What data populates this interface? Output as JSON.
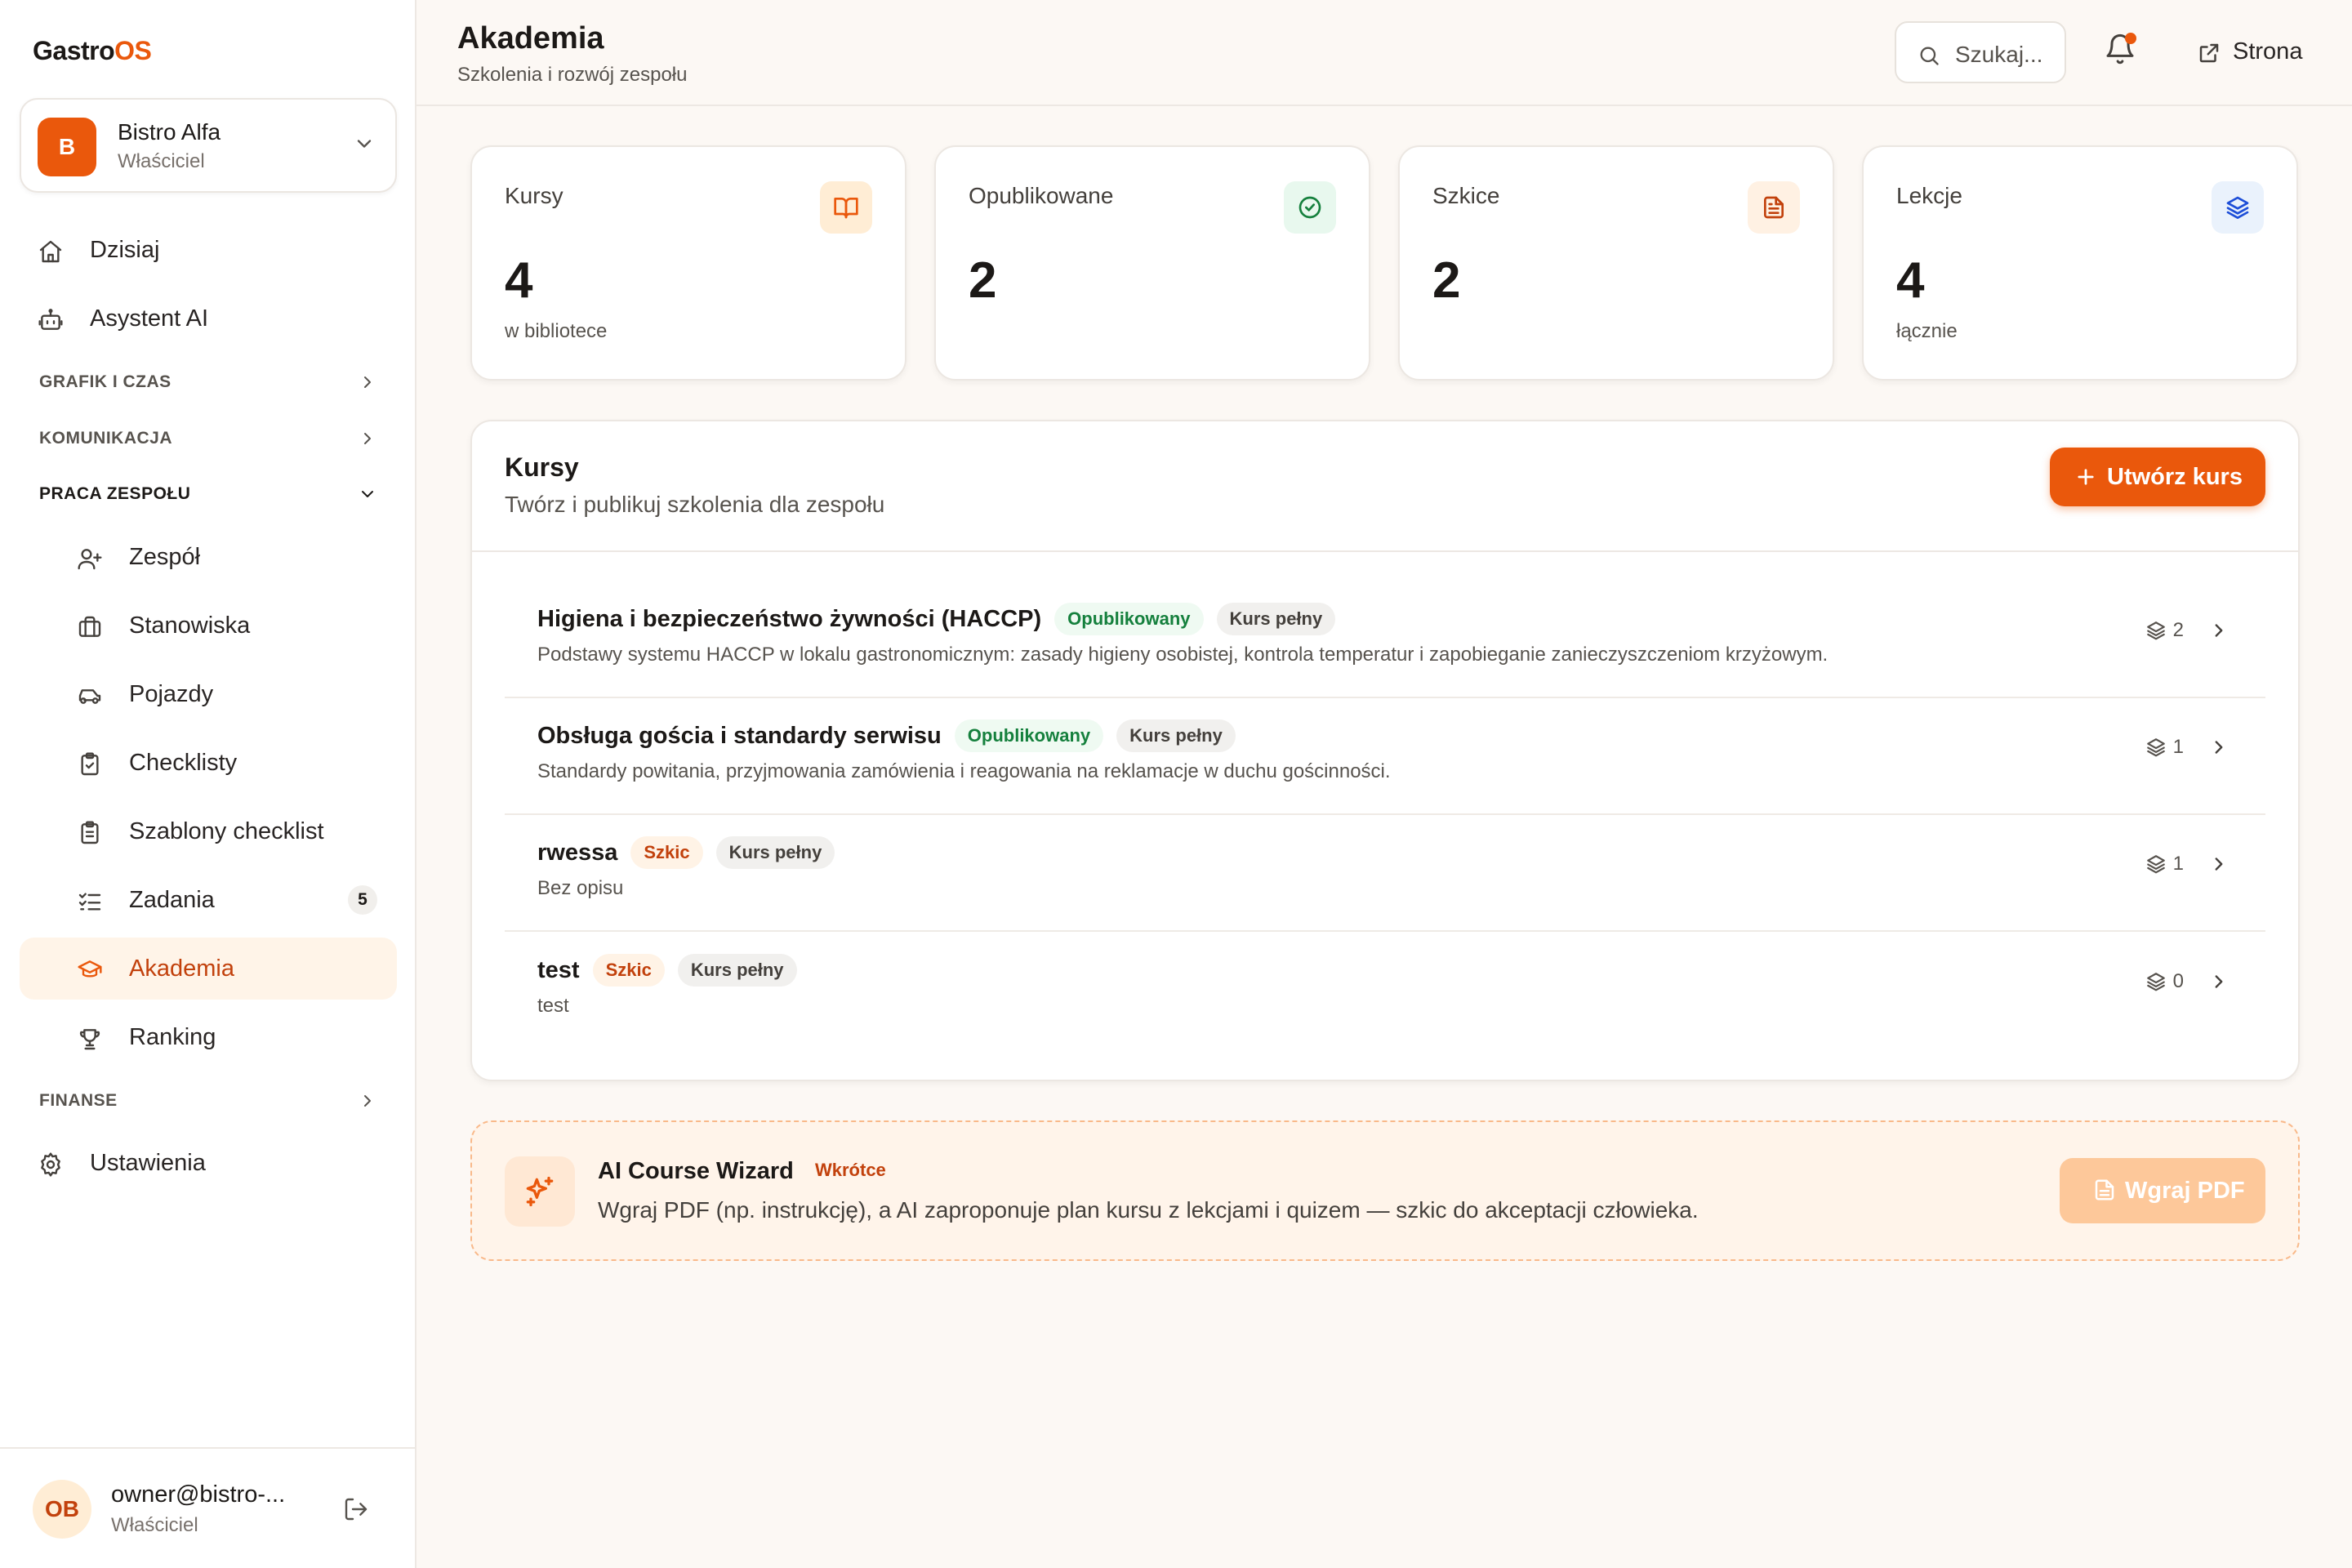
{
  "app": {
    "logo_main": "Gastro",
    "logo_accent": "OS"
  },
  "org": {
    "avatar": "B",
    "name": "Bistro Alfa",
    "role": "Właściciel"
  },
  "sidebar": {
    "top_items": [
      {
        "label": "Dzisiaj",
        "icon": "home-icon"
      },
      {
        "label": "Asystent AI",
        "icon": "bot-icon"
      }
    ],
    "sections": {
      "schedule": "GRAFIK I CZAS",
      "communication": "KOMUNIKACJA",
      "teamwork": "PRACA ZESPOŁU",
      "finance": "FINANSE"
    },
    "team_items": [
      {
        "label": "Zespół",
        "icon": "user-plus-icon"
      },
      {
        "label": "Stanowiska",
        "icon": "briefcase-icon"
      },
      {
        "label": "Pojazdy",
        "icon": "car-icon"
      },
      {
        "label": "Checklisty",
        "icon": "clipboard-check-icon"
      },
      {
        "label": "Szablony checklist",
        "icon": "clipboard-list-icon"
      },
      {
        "label": "Zadania",
        "icon": "list-checks-icon",
        "badge": "5"
      },
      {
        "label": "Akademia",
        "icon": "graduation-cap-icon",
        "active": true
      },
      {
        "label": "Ranking",
        "icon": "trophy-icon"
      }
    ],
    "settings": {
      "label": "Ustawienia",
      "icon": "gear-icon"
    }
  },
  "user": {
    "initials": "OB",
    "email": "owner@bistro-...",
    "role": "Właściciel"
  },
  "header": {
    "title": "Akademia",
    "subtitle": "Szkolenia i rozwój zespołu",
    "search_placeholder": "Szukaj...",
    "site_link": "Strona"
  },
  "stats": [
    {
      "label": "Kursy",
      "value": "4",
      "note": "w bibliotece",
      "icon": "book-open-icon"
    },
    {
      "label": "Opublikowane",
      "value": "2",
      "note": "",
      "icon": "check-circle-icon"
    },
    {
      "label": "Szkice",
      "value": "2",
      "note": "",
      "icon": "file-text-icon"
    },
    {
      "label": "Lekcje",
      "value": "4",
      "note": "łącznie",
      "icon": "layers-icon"
    }
  ],
  "courses_panel": {
    "title": "Kursy",
    "subtitle": "Twórz i publikuj szkolenia dla zespołu",
    "create_button": "Utwórz kurs"
  },
  "courses": [
    {
      "title": "Higiena i bezpieczeństwo żywności (HACCP)",
      "status": "Opublikowany",
      "status_type": "pub",
      "kind": "Kurs pełny",
      "description": "Podstawy systemu HACCP w lokalu gastronomicznym: zasady higieny osobistej, kontrola temperatur i zapobieganie zanieczyszczeniom krzyżowym.",
      "lessons": "2"
    },
    {
      "title": "Obsługa gościa i standardy serwisu",
      "status": "Opublikowany",
      "status_type": "pub",
      "kind": "Kurs pełny",
      "description": "Standardy powitania, przyjmowania zamówienia i reagowania na reklamacje w duchu gościnności.",
      "lessons": "1"
    },
    {
      "title": "rwessa",
      "status": "Szkic",
      "status_type": "draft",
      "kind": "Kurs pełny",
      "description": "Bez opisu",
      "lessons": "1"
    },
    {
      "title": "test",
      "status": "Szkic",
      "status_type": "draft",
      "kind": "Kurs pełny",
      "description": "test",
      "lessons": "0"
    }
  ],
  "ai_wizard": {
    "title": "AI Course Wizard",
    "badge": "Wkrótce",
    "description": "Wgraj PDF (np. instrukcję), a AI zaproponuje plan kursu z lekcjami i quizem — szkic do akceptacji człowieka.",
    "button": "Wgraj PDF"
  },
  "colors": {
    "accent": "#ea580c",
    "accent_soft": "#fff4e8",
    "published": "#15803d",
    "draft": "#c2410c"
  }
}
